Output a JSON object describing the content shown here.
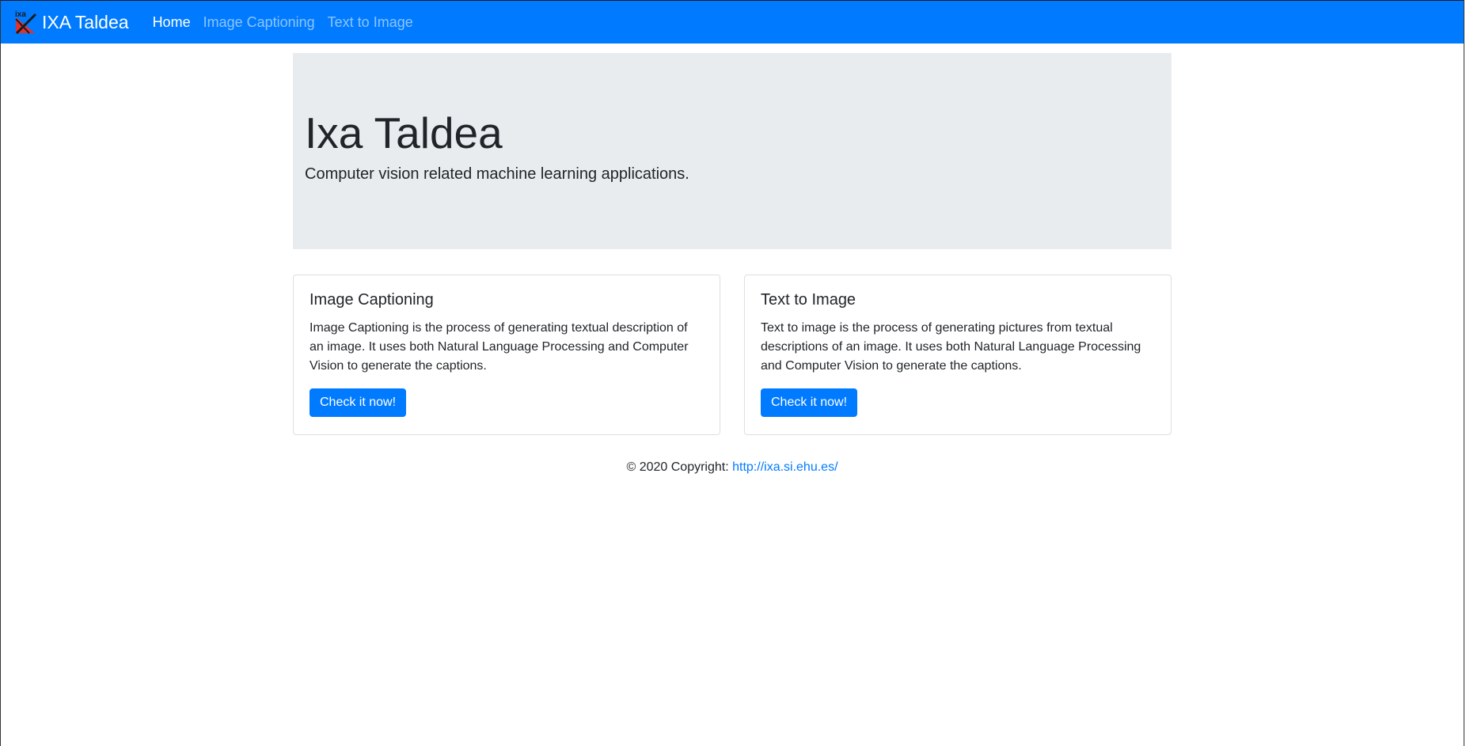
{
  "navbar": {
    "brand": "IXA Taldea",
    "logo_text": "ixa",
    "links": [
      {
        "label": "Home",
        "active": true
      },
      {
        "label": "Image Captioning",
        "active": false
      },
      {
        "label": "Text to Image",
        "active": false
      }
    ]
  },
  "jumbotron": {
    "title": "Ixa Taldea",
    "lead": "Computer vision related machine learning applications."
  },
  "cards": [
    {
      "title": "Image Captioning",
      "text": "Image Captioning is the process of generating textual description of an image. It uses both Natural Language Processing and Computer Vision to generate the captions.",
      "button": "Check it now!"
    },
    {
      "title": "Text to Image",
      "text": "Text to image is the process of generating pictures from textual descriptions of an image. It uses both Natural Language Processing and Computer Vision to generate the captions.",
      "button": "Check it now!"
    }
  ],
  "footer": {
    "copyright": "© 2020 Copyright: ",
    "link": "http://ixa.si.ehu.es/"
  },
  "colors": {
    "primary": "#007bff",
    "jumbotron_bg": "#e9ecef",
    "text": "#212529"
  }
}
